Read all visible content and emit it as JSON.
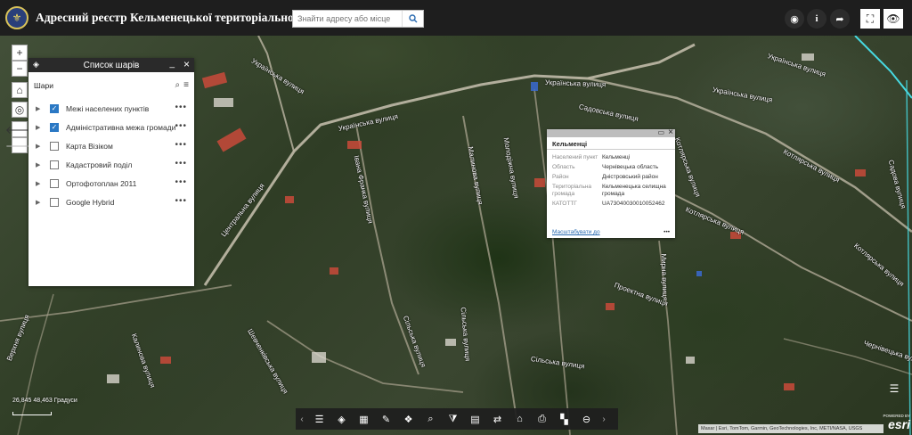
{
  "header": {
    "title": "Адресний реєстр Кельменецької територіальної громади",
    "search_placeholder": "Знайти адресу або місце"
  },
  "layer_list": {
    "title": "Список шарів",
    "section_label": "Шари",
    "items": [
      {
        "label": "Межі населених пунктів",
        "checked": true
      },
      {
        "label": "Адміністративна межа громади",
        "checked": true
      },
      {
        "label": "Карта Візіком",
        "checked": false
      },
      {
        "label": "Кадастровий поділ",
        "checked": false
      },
      {
        "label": "Ортофотоплан 2011",
        "checked": false
      },
      {
        "label": "Google Hybrid",
        "checked": false
      }
    ],
    "more_glyph": "•••"
  },
  "popup": {
    "title": "Кельменці",
    "rows": [
      {
        "key": "Населений пункт",
        "value": "Кельменці"
      },
      {
        "key": "Область",
        "value": "Чернівецька область"
      },
      {
        "key": "Район",
        "value": "Дністровський район"
      },
      {
        "key": "Територіальна громада",
        "value": "Кельменецька селищна громада"
      },
      {
        "key": "КАТОТТГ",
        "value": "UA73040030010052462"
      }
    ],
    "zoom_link": "Масштабувати до",
    "more_glyph": "•••"
  },
  "streets": [
    {
      "name": "Українська вулиця"
    },
    {
      "name": "Українська вулиця"
    },
    {
      "name": "Українська вулиця"
    },
    {
      "name": "Українська вулиця"
    },
    {
      "name": "Садовська вулиця"
    },
    {
      "name": "Котлярська вулиця"
    },
    {
      "name": "Котлярська вулиця"
    },
    {
      "name": "Центральна вулиця"
    },
    {
      "name": "Українська вулиця"
    },
    {
      "name": "Котлярська вулиця"
    },
    {
      "name": "Сільська вулиця"
    },
    {
      "name": "Сільська вулиця"
    },
    {
      "name": "Сільська вулиця"
    },
    {
      "name": "Івана Франка вулиця"
    },
    {
      "name": "Малинова вулиця"
    },
    {
      "name": "Молодіжна вулиця"
    },
    {
      "name": "Мирна вулиця"
    },
    {
      "name": "Верхня вулиця"
    },
    {
      "name": "Шевченківська вулиця"
    },
    {
      "name": "Проектна вулиця"
    },
    {
      "name": "Садова вулиця"
    },
    {
      "name": "Чернівецька вулиця"
    },
    {
      "name": "Калинова вулиця"
    },
    {
      "name": "Котлярська вулиця"
    }
  ],
  "coords": "26,845 48,463 Градуси",
  "scale": "",
  "attribution": "Maxar | Esri, TomTom, Garmin, GeoTechnologies, Inc, METI/NASA, USGS",
  "esri": {
    "powered": "POWERED BY",
    "brand": "esri"
  },
  "colors": {
    "header_bg": "#1e1e1e",
    "accent": "#2a78c4",
    "toolbar_bg": "#1e1e1e"
  }
}
